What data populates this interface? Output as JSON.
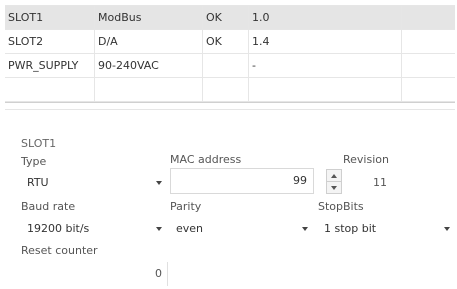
{
  "table": {
    "rows": [
      [
        "SLOT1",
        "ModBus",
        "OK",
        "1.0",
        ""
      ],
      [
        "SLOT2",
        "D/A",
        "OK",
        "1.4",
        ""
      ],
      [
        "PWR_SUPPLY",
        "90-240VAC",
        "",
        "-",
        ""
      ],
      [
        "",
        "",
        "",
        "",
        ""
      ]
    ]
  },
  "details": {
    "section_title": "SLOT1",
    "type_label": "Type",
    "type_value": "RTU",
    "mac_label": "MAC address",
    "mac_value": "99",
    "revision_label": "Revision",
    "revision_value": "11",
    "baud_label": "Baud rate",
    "baud_value": "19200 bit/s",
    "parity_label": "Parity",
    "parity_value": "even",
    "stopbits_label": "StopBits",
    "stopbits_value": "1 stop bit",
    "reset_label": "Reset counter",
    "reset_value": "0"
  }
}
